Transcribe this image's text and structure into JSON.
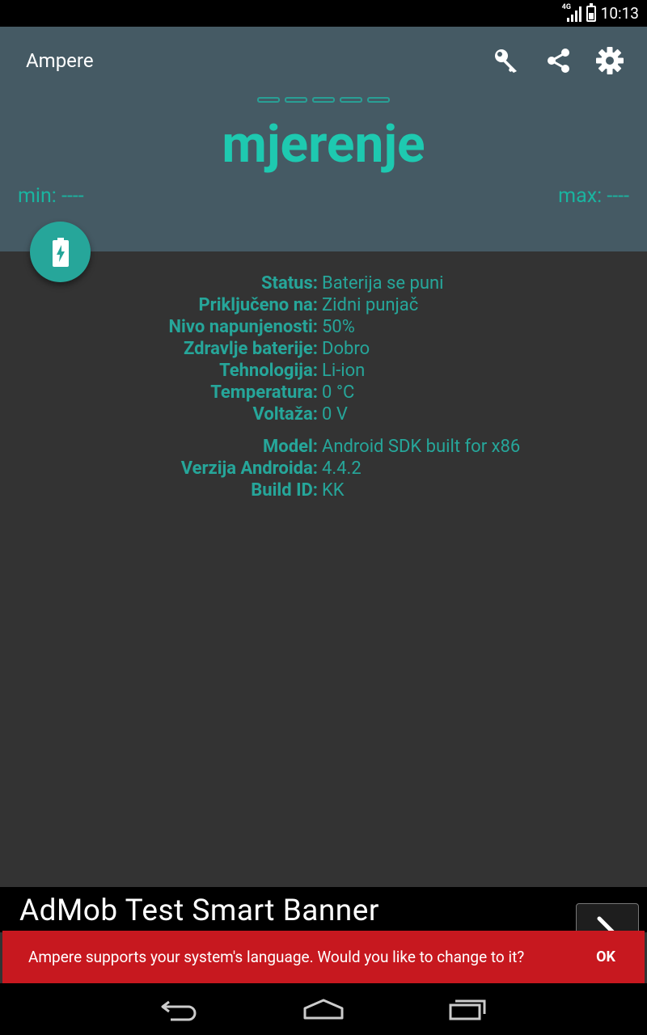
{
  "status_bar": {
    "network": "4G",
    "time": "10:13"
  },
  "app": {
    "title": "Ampere"
  },
  "toolbar": {
    "icons": [
      "key-icon",
      "share-icon",
      "settings-icon"
    ]
  },
  "meter": {
    "dashes": "-----",
    "measuring_label": "mjerenje",
    "min_label": "min: ----",
    "max_label": "max: ----"
  },
  "fab": {
    "icon": "battery-charging-icon"
  },
  "battery_info": [
    {
      "label": "Status:",
      "value": "Baterija se puni"
    },
    {
      "label": "Priključeno na:",
      "value": "Zidni punjač"
    },
    {
      "label": "Nivo napunjenosti:",
      "value": "50%"
    },
    {
      "label": "Zdravlje baterije:",
      "value": "Dobro"
    },
    {
      "label": "Tehnologija:",
      "value": "Li-ion"
    },
    {
      "label": "Temperatura:",
      "value": "0 °C"
    },
    {
      "label": "Voltaža:",
      "value": "0 V"
    }
  ],
  "device_info": [
    {
      "label": "Model:",
      "value": "Android SDK built for x86"
    },
    {
      "label": "Verzija Androida:",
      "value": "4.4.2"
    },
    {
      "label": "Build ID:",
      "value": "KK"
    }
  ],
  "ad": {
    "text": "AdMob Test Smart Banner"
  },
  "snackbar": {
    "message": "Ampere supports your system's language. Would you like to change to it?",
    "action": "OK"
  },
  "colors": {
    "accent": "#26a69a",
    "header": "#455a64",
    "background": "#333333",
    "snackbar": "#c7181f"
  }
}
